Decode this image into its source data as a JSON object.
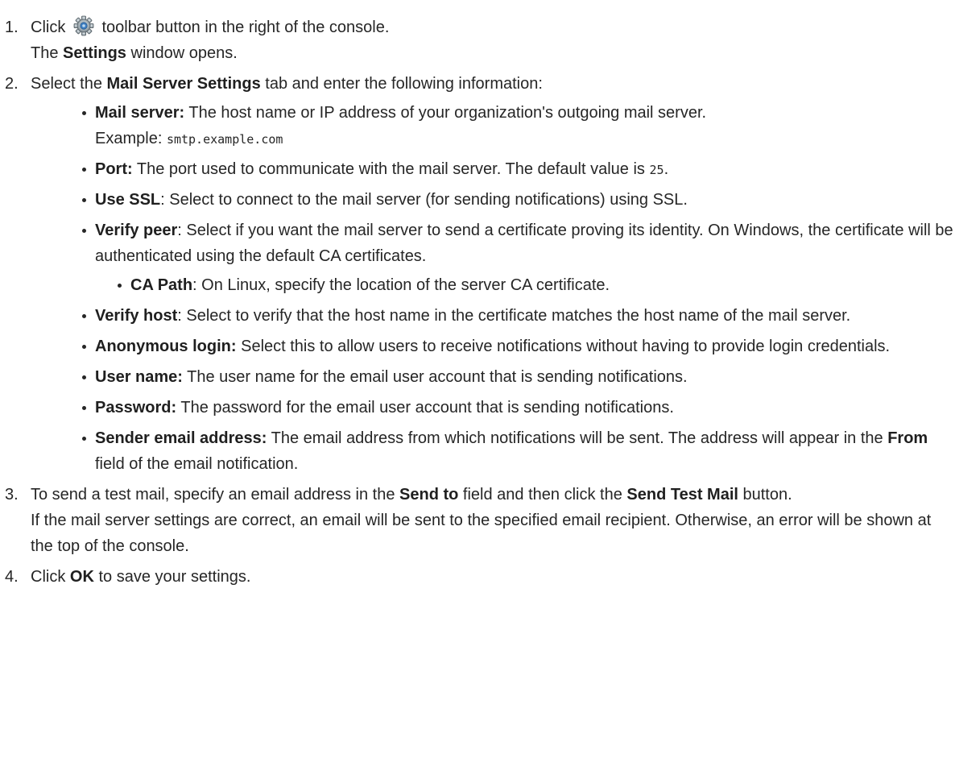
{
  "steps": [
    {
      "num": "1.",
      "p1_a": "Click",
      "p1_b": "toolbar button in the right of the console.",
      "p2_a": "The",
      "p2_bold": "Settings",
      "p2_b": "window opens.",
      "icon": "gear-icon"
    },
    {
      "num": "2.",
      "a": "Select the",
      "bold": "Mail Server Settings",
      "b": "tab and enter the following information:",
      "items": [
        {
          "term": "Mail server:",
          "text": "The host name or IP address of your organization's outgoing mail server.",
          "line2": "Example:",
          "code": "smtp.example.com"
        },
        {
          "term": "Port:",
          "text": "The port used to communicate with the mail server. The default value is",
          "code": "25",
          "after": "."
        },
        {
          "term": "Use SSL",
          "text": ": Select to connect to the mail server (for sending notifications) using SSL."
        },
        {
          "term": "Verify peer",
          "text": ": Select if you want the mail server to send a certificate proving its identity. On Windows, the certificate will be authenticated using the default CA certificates.",
          "sub": {
            "term": "CA Path",
            "text": ": On Linux, specify the location of the server CA certificate."
          }
        },
        {
          "term": "Verify host",
          "text": ": Select to verify that the host name in the certificate matches the host name of the mail server."
        },
        {
          "term": "Anonymous login:",
          "text": "Select this to allow users to receive notifications without having to provide login credentials."
        },
        {
          "term": "User name:",
          "text": "The user name for the email user account that is sending notifications."
        },
        {
          "term": "Password:",
          "text": "The password for the email user account that is sending notifications."
        },
        {
          "term": "Sender email address:",
          "text": "The email address from which notifications will be sent. The address will appear in the",
          "bold2": "From",
          "after": "field of the email notification."
        }
      ]
    },
    {
      "num": "3.",
      "a": "To send a test mail, specify an email address in the",
      "bold1": "Send to",
      "b": "field and then click the",
      "bold2": "Send Test Mail",
      "c": "button.",
      "p2": "If the mail server settings are correct, an email will be sent to the specified email recipient. Otherwise, an error will be shown at the top of the console."
    },
    {
      "num": "4.",
      "a": "Click",
      "bold": "OK",
      "b": "to save your settings."
    }
  ]
}
